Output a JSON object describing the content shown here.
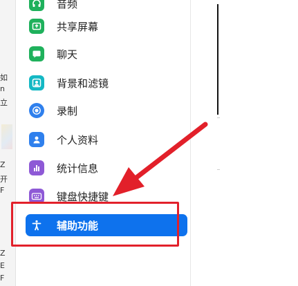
{
  "sidebar": {
    "items": [
      {
        "label": "音频",
        "icon": "headphones-icon",
        "color": "#1fb15c"
      },
      {
        "label": "共享屏幕",
        "icon": "share-screen-icon",
        "color": "#1fb15c"
      },
      {
        "label": "聊天",
        "icon": "chat-bubble-icon",
        "color": "#1fb15c"
      },
      {
        "label": "背景和滤镜",
        "icon": "background-person-icon",
        "color": "#14b8c4"
      },
      {
        "label": "录制",
        "icon": "record-icon",
        "color": "#2f80ed"
      },
      {
        "label": "个人资料",
        "icon": "profile-user-icon",
        "color": "#2f80ed"
      },
      {
        "label": "统计信息",
        "icon": "stats-bar-chart-icon",
        "color": "#8e59d6"
      },
      {
        "label": "键盘快捷键",
        "icon": "keyboard-icon",
        "color": "#8e59d6"
      },
      {
        "label": "辅助功能",
        "icon": "accessibility-icon",
        "color": "#ffffff",
        "active": true
      }
    ]
  },
  "background_window": {
    "fragments": [
      "如",
      "n",
      "立",
      "Z",
      "开",
      "F",
      "Z",
      "E",
      "F"
    ]
  },
  "colors": {
    "accent": "#0e72ed",
    "annotation_red": "#e2202a"
  }
}
